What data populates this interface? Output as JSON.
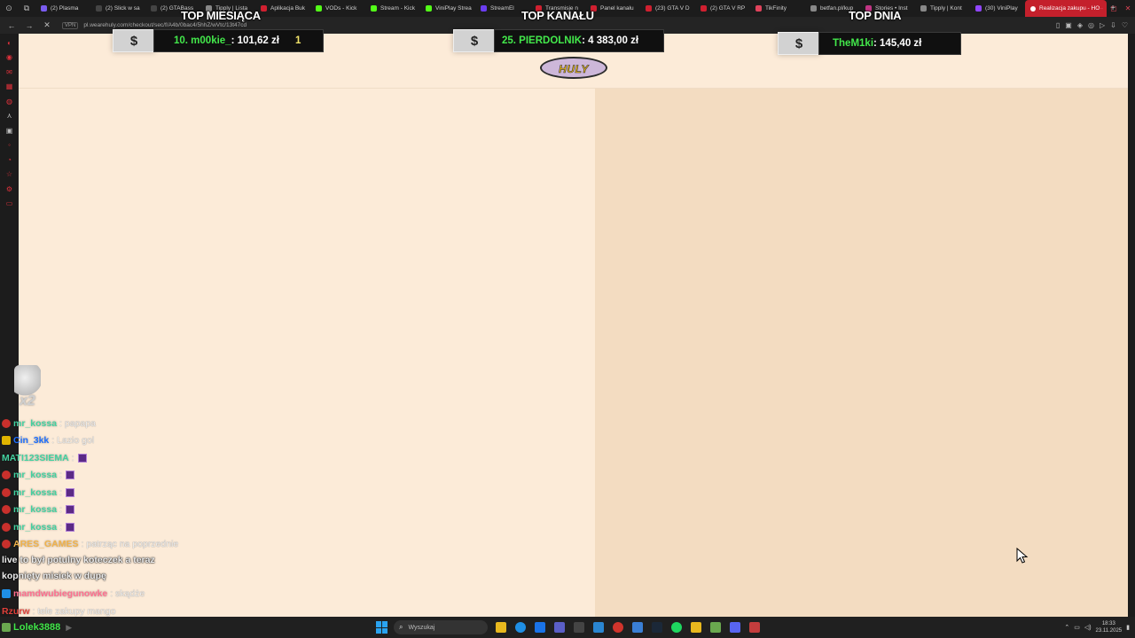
{
  "browser": {
    "tabs": [
      {
        "label": "(2) Plasma",
        "color": "#7a5cf0"
      },
      {
        "label": "(2) Slick w sa",
        "color": "#444"
      },
      {
        "label": "(2) GTABass",
        "color": "#444"
      },
      {
        "label": "Tipply | Lista",
        "color": "#888"
      },
      {
        "label": "Aplikacja Buk",
        "color": "#d02030"
      },
      {
        "label": "VODs - Kick",
        "color": "#53fc18"
      },
      {
        "label": "Stream - Kick",
        "color": "#53fc18"
      },
      {
        "label": "ViniPlay Strea",
        "color": "#53fc18"
      },
      {
        "label": "StreamEl",
        "color": "#6b3df0"
      },
      {
        "label": "Transmisje n",
        "color": "#d02030"
      },
      {
        "label": "Panel kanału",
        "color": "#d02030"
      },
      {
        "label": "(23) GTA V D",
        "color": "#d02030"
      },
      {
        "label": "(2) GTA V RP",
        "color": "#d02030"
      },
      {
        "label": "TikFinity",
        "color": "#e0435c"
      },
      {
        "label": "betfan.pl/kup",
        "color": "#888"
      },
      {
        "label": "Stories • Inst",
        "color": "#c13584"
      },
      {
        "label": "Tipply | Kont",
        "color": "#888"
      },
      {
        "label": "(30) ViniPlay",
        "color": "#9146ff"
      }
    ],
    "active_tab": {
      "label": "Realizacja zakupu - HO",
      "color": "#ffffff"
    },
    "address": {
      "badge": "VPN",
      "url": "pl.wearehuly.com/checkout/sec/f/A4b/0bac4/5hhZ/wVtc/13t47cd"
    },
    "sidebar_icons": [
      "home-icon",
      "notes-icon",
      "mail-icon",
      "calendar-icon",
      "chat-icon",
      "arrow-icon",
      "twitch-icon",
      "dot-icon",
      "clock-icon",
      "star-icon",
      "settings-icon",
      "bookmark-icon"
    ]
  },
  "overlay": {
    "top_cards": [
      {
        "title": "TOP MIESIĄCA",
        "icon": "$",
        "donor": "10. m00kie_",
        "amount": ": 101,62 zł",
        "extra": "1"
      },
      {
        "title": "TOP KANAŁU",
        "icon": "$",
        "donor": "25. PIERDOLNIK",
        "amount": ": 4 383,00 zł",
        "extra": ""
      },
      {
        "title": "TOP DNIA",
        "icon": "$",
        "donor": "TheM1ki",
        "amount": ": 145,40 zł",
        "extra": ""
      }
    ],
    "logo_text": "HULY",
    "emote_count": "x2"
  },
  "chat": [
    {
      "badge": "live",
      "user": "mr_kossa",
      "color": "#43d1a0",
      "msg": ": papapa",
      "emote": false
    },
    {
      "badge": "star",
      "user": "Cin_3kk",
      "color": "#1e6fff",
      "msg": ": Lazio gol",
      "emote": false
    },
    {
      "badge": "",
      "user": "MATI123SIEMA",
      "color": "#43d1a0",
      "msg": ":",
      "emote": true
    },
    {
      "badge": "live",
      "user": "mr_kossa",
      "color": "#43d1a0",
      "msg": ":",
      "emote": true
    },
    {
      "badge": "live",
      "user": "mr_kossa",
      "color": "#43d1a0",
      "msg": ":",
      "emote": true
    },
    {
      "badge": "live",
      "user": "mr_kossa",
      "color": "#43d1a0",
      "msg": ":",
      "emote": true
    },
    {
      "badge": "live",
      "user": "mr_kossa",
      "color": "#43d1a0",
      "msg": ":",
      "emote": true
    },
    {
      "badge": "live",
      "user": "ARES_GAMES",
      "color": "#f1b24a",
      "msg": ": patrząc na poprzednie",
      "emote": false
    }
  ],
  "chat_wrap": [
    "live to był potulny koteczek a teraz",
    "kopnięty misiek w dupę"
  ],
  "chat_tail": [
    {
      "badge": "mod",
      "user": "mamdwubiegunowke",
      "color": "#ff6f8f",
      "msg": ": skądże"
    },
    {
      "badge": "",
      "user": "Rzurw",
      "color": "#e0403a",
      "msg": ": tele zakupy mango"
    }
  ],
  "viewer": {
    "user": "Lolek3888"
  },
  "taskbar": {
    "search_placeholder": "Wyszukaj",
    "apps": [
      "files-icon",
      "edge-icon",
      "mail-icon",
      "teams-icon",
      "terminal-icon",
      "vscode-icon",
      "opera-icon",
      "vscode-alt-icon",
      "steam-icon",
      "spotify-icon",
      "folder-icon",
      "archive-icon",
      "discord-icon",
      "media-icon"
    ],
    "time": "18:33",
    "date": "23.11.2025"
  }
}
